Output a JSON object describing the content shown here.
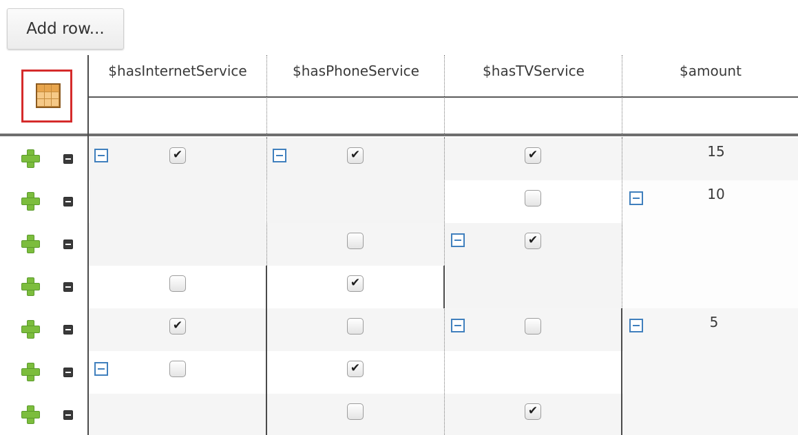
{
  "toolbar": {
    "add_row_label": "Add row..."
  },
  "table": {
    "columns": [
      "$hasInternetService",
      "$hasPhoneService",
      "$hasTVService",
      "$amount"
    ],
    "rows": [
      {
        "internet": "checked",
        "phone": "checked",
        "tv": "checked",
        "amount": "15"
      },
      {
        "internet": "checked",
        "phone": "checked",
        "tv": "unchecked",
        "amount": "10"
      },
      {
        "internet": "checked",
        "phone": "unchecked",
        "tv": "checked",
        "amount": "10"
      },
      {
        "internet": "unchecked",
        "phone": "checked",
        "tv": "checked",
        "amount": "10"
      },
      {
        "internet": "checked",
        "phone": "unchecked",
        "tv": "unchecked",
        "amount": "5"
      },
      {
        "internet": "unchecked",
        "phone": "checked",
        "tv": "unchecked",
        "amount": "5"
      },
      {
        "internet": "unchecked",
        "phone": "unchecked",
        "tv": "checked",
        "amount": "5"
      }
    ]
  },
  "icons": {
    "decision_table": "decision-table-icon",
    "add_row": "plus-icon",
    "delete_row": "minus-icon",
    "merge_toggle": "collapse-icon"
  },
  "colors": {
    "plus": "#7cbd3d",
    "collapse": "#3f7fbd",
    "selected_icon_border": "#d52b2b"
  }
}
